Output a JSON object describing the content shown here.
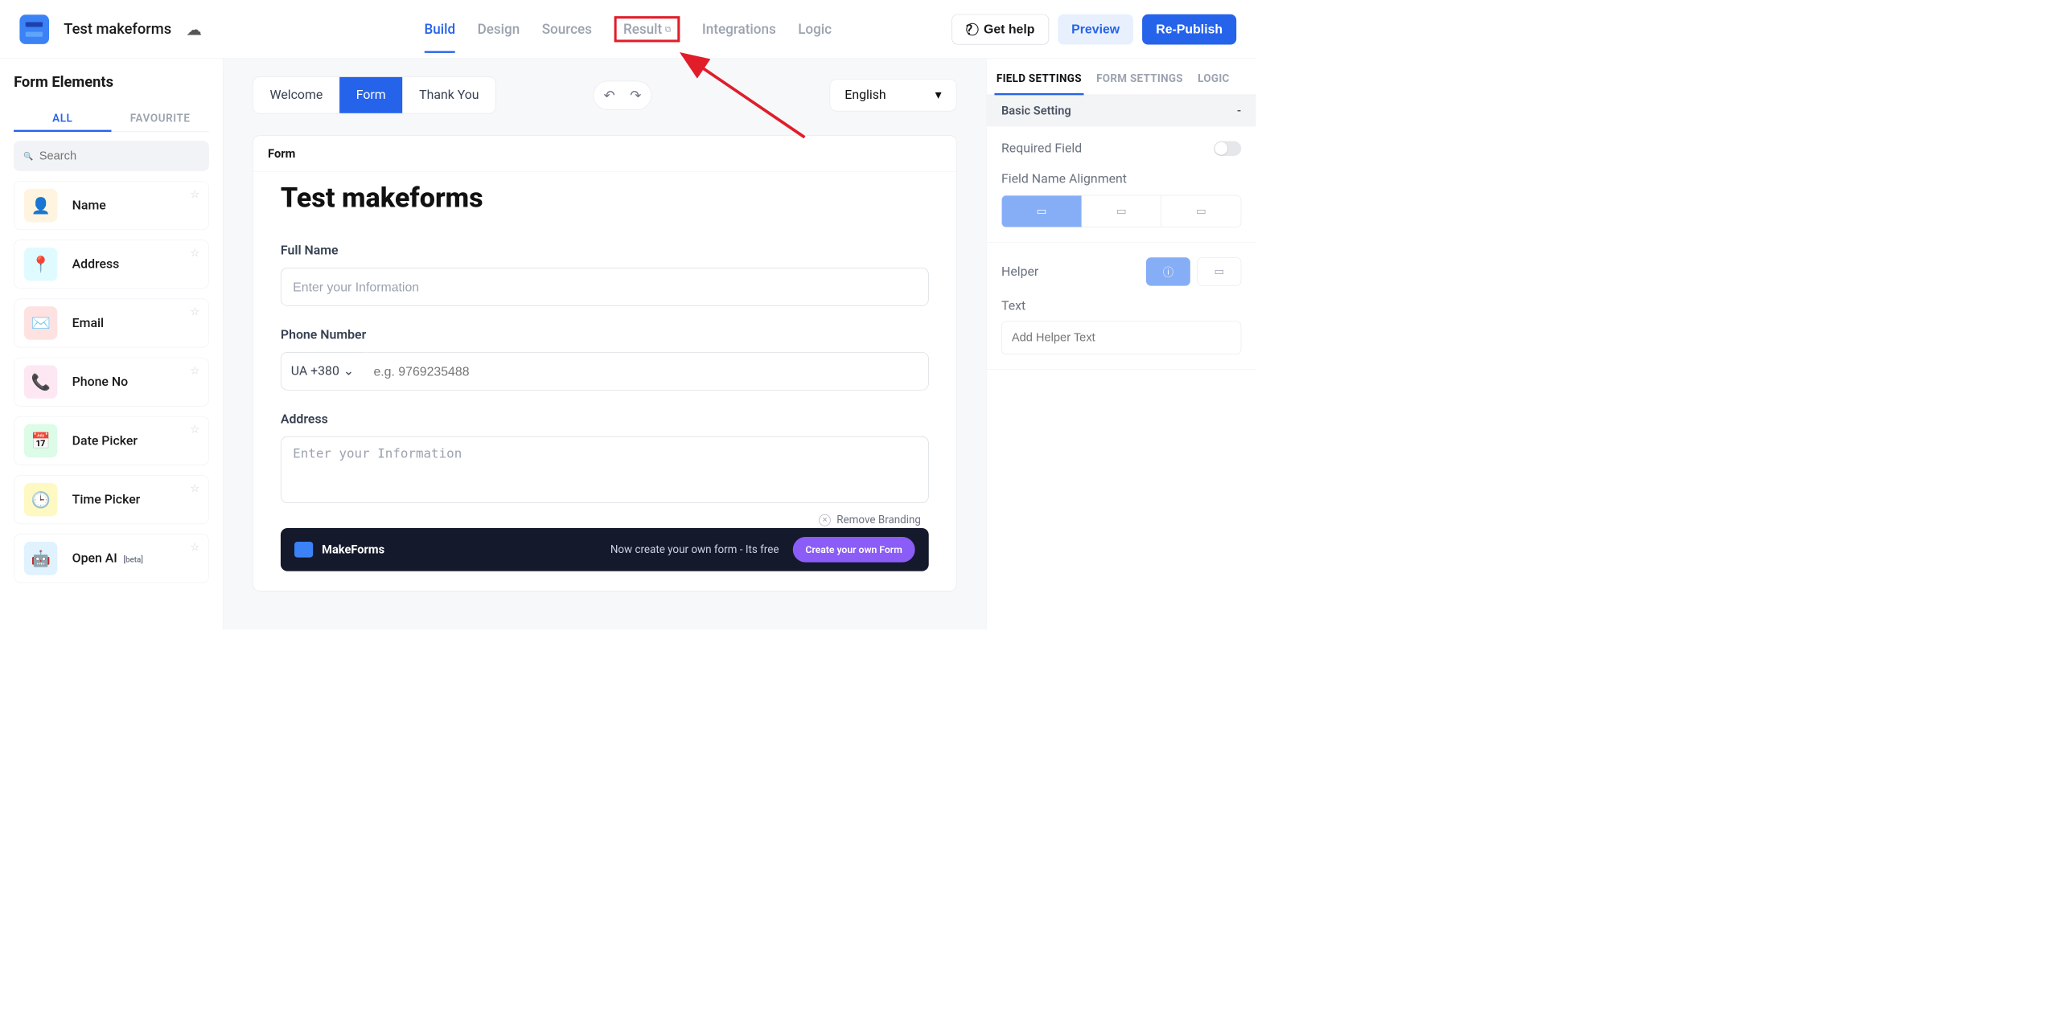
{
  "header": {
    "form_name": "Test makeforms",
    "nav": {
      "build": "Build",
      "design": "Design",
      "sources": "Sources",
      "result": "Result",
      "integrations": "Integrations",
      "logic": "Logic"
    },
    "get_help": "Get help",
    "preview": "Preview",
    "republish": "Re-Publish"
  },
  "sidebar": {
    "title": "Form Elements",
    "tabs": {
      "all": "ALL",
      "favourite": "FAVOURITE"
    },
    "search_placeholder": "Search",
    "items": [
      {
        "label": "Name",
        "bg": "#fff4e0",
        "emoji": "👤"
      },
      {
        "label": "Address",
        "bg": "#e0fbff",
        "emoji": "📍"
      },
      {
        "label": "Email",
        "bg": "#fee2e2",
        "emoji": "✉️"
      },
      {
        "label": "Phone No",
        "bg": "#fce7f3",
        "emoji": "📞"
      },
      {
        "label": "Date Picker",
        "bg": "#dcfce7",
        "emoji": "📅"
      },
      {
        "label": "Time Picker",
        "bg": "#fef9c3",
        "emoji": "🕒"
      },
      {
        "label": "Open AI",
        "bg": "#e0f2fe",
        "emoji": "🤖",
        "badge": "[beta]"
      }
    ]
  },
  "canvas": {
    "steps": {
      "welcome": "Welcome",
      "form": "Form",
      "thank_you": "Thank You"
    },
    "language": "English",
    "card_head": "Form",
    "form_title": "Test makeforms",
    "fields": {
      "full_name": {
        "label": "Full Name",
        "placeholder": "Enter your Information"
      },
      "phone": {
        "label": "Phone Number",
        "cc": "UA +380",
        "placeholder": "e.g. 9769235488"
      },
      "address": {
        "label": "Address",
        "placeholder": "Enter your Information"
      }
    },
    "remove_branding": "Remove Branding",
    "promo": {
      "brand": "MakeForms",
      "tagline": "Now create your own form - Its free",
      "cta": "Create your own Form"
    }
  },
  "rpanel": {
    "tabs": {
      "field": "FIELD SETTINGS",
      "form": "FORM SETTINGS",
      "logic": "LOGIC"
    },
    "section": "Basic Setting",
    "collapse": "-",
    "required_label": "Required Field",
    "alignment_label": "Field Name Alignment",
    "helper_label": "Helper",
    "text_label": "Text",
    "helper_placeholder": "Add Helper Text"
  }
}
